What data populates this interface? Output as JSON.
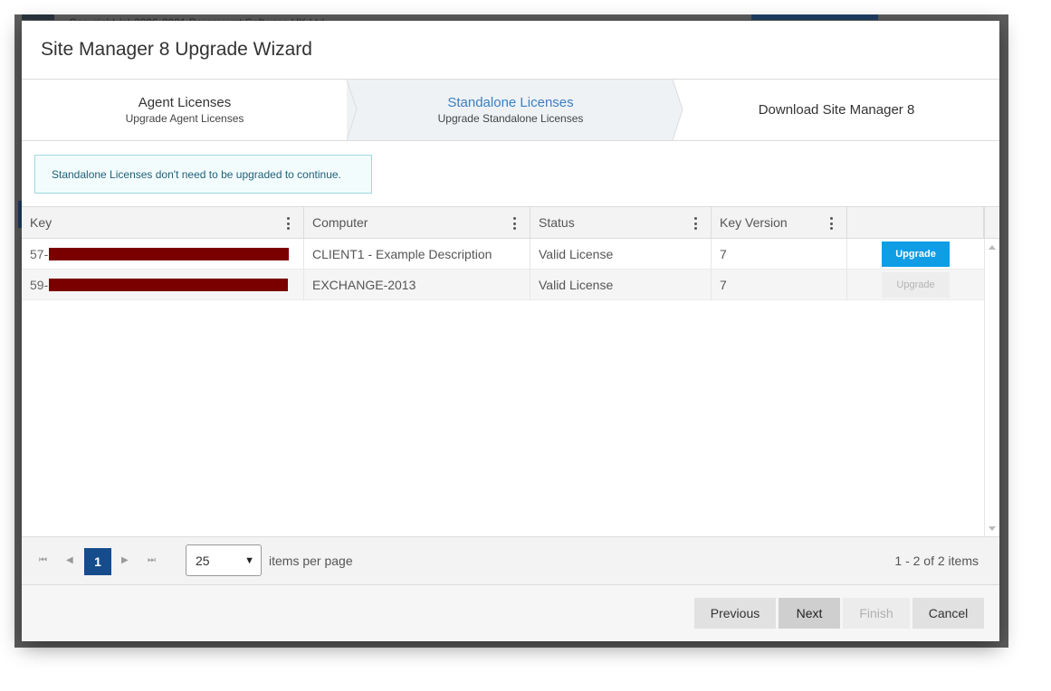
{
  "background": {
    "copyright": "Copyright (c) 2006-2021 Paramount Software UK Ltd."
  },
  "dialog": {
    "title": "Site Manager 8 Upgrade Wizard"
  },
  "steps": [
    {
      "title": "Agent Licenses",
      "subtitle": "Upgrade Agent Licenses",
      "active": false
    },
    {
      "title": "Standalone Licenses",
      "subtitle": "Upgrade Standalone Licenses",
      "active": true
    },
    {
      "title": "Download Site Manager 8",
      "subtitle": "",
      "active": false
    }
  ],
  "info": {
    "message": "Standalone Licenses don't need to be upgraded to continue."
  },
  "grid": {
    "columns": [
      "Key",
      "Computer",
      "Status",
      "Key Version",
      ""
    ],
    "rows": [
      {
        "key_prefix": "57-",
        "computer": "CLIENT1 - Example Description",
        "status": "Valid License",
        "version": "7",
        "action": "Upgrade",
        "action_enabled": true
      },
      {
        "key_prefix": "59-",
        "computer": "EXCHANGE-2013",
        "status": "Valid License",
        "version": "7",
        "action": "Upgrade",
        "action_enabled": false
      }
    ]
  },
  "pager": {
    "current_page": "1",
    "page_size": "25",
    "items_per_page_label": "items per page",
    "info": "1 - 2 of 2 items"
  },
  "footer": {
    "previous": "Previous",
    "next": "Next",
    "finish": "Finish",
    "cancel": "Cancel"
  },
  "colors": {
    "accent": "#0f9de6",
    "active_step_text": "#3a7fc1",
    "page_button": "#154c8c",
    "redaction": "#7a0000"
  },
  "icons": [
    "first-page-icon",
    "prev-page-icon",
    "next-page-icon",
    "last-page-icon",
    "column-menu-icon",
    "chevron-down-icon"
  ]
}
